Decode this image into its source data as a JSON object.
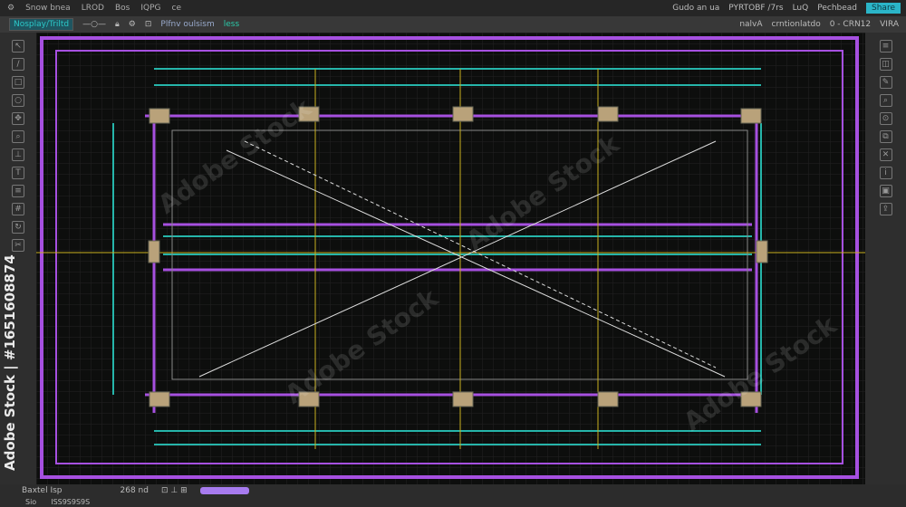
{
  "menubar": {
    "items": [
      "Snow bnea",
      "LROD",
      "Bos",
      "IQPG",
      "ce"
    ],
    "right": [
      "Gudo an ua",
      "PYRTOBF /7rs",
      "LuQ",
      "Pechbead"
    ],
    "badge": "Share"
  },
  "toolbar": {
    "field": "Nosplay/Triltd",
    "label": "Plfnv oulsism",
    "label_suffix": "less",
    "right": [
      "nalvA",
      "crntionlatdo",
      "0 - CRN12",
      "VIRA"
    ]
  },
  "bottom": {
    "layer": "Baxtel Isp",
    "zoom": "268 nd",
    "status": "Sio",
    "coords": "ISS9S9S9S",
    "progress": 1.0
  },
  "watermark": {
    "brand": "Adobe Stock",
    "id": "#1651608874"
  },
  "colors": {
    "purple": "#a650e0",
    "teal": "#26b5aa",
    "yellow": "#c9b020",
    "accent": "#2bb5c8"
  }
}
